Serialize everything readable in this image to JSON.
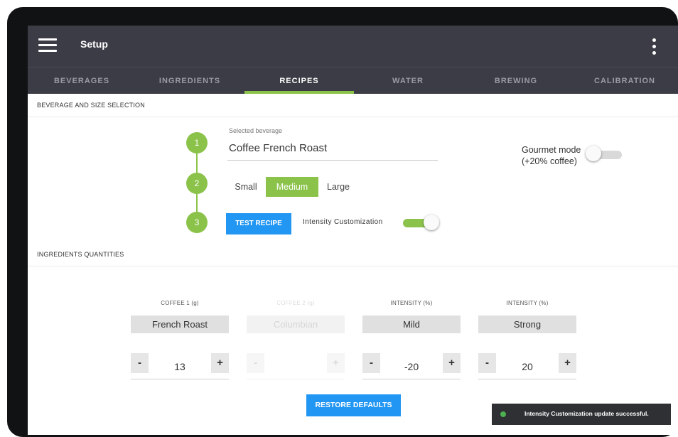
{
  "appbar": {
    "title": "Setup"
  },
  "tabs": [
    {
      "label": "BEVERAGES"
    },
    {
      "label": "INGREDIENTS"
    },
    {
      "label": "RECIPES"
    },
    {
      "label": "WATER"
    },
    {
      "label": "BREWING"
    },
    {
      "label": "CALIBRATION"
    }
  ],
  "active_tab": "RECIPES",
  "beverage_section": {
    "heading": "BEVERAGE AND SIZE SELECTION",
    "steps": [
      "1",
      "2",
      "3"
    ],
    "selected_beverage_label": "Selected beverage",
    "selected_beverage_value": "Coffee French Roast",
    "gourmet_mode_line1": "Gourmet mode",
    "gourmet_mode_line2": "(+20% coffee)",
    "gourmet_mode_on": false,
    "sizes": [
      "Small",
      "Medium",
      "Large"
    ],
    "selected_size": "Medium",
    "test_recipe_label": "TEST RECIPE",
    "intensity_customization_label": "Intensity Customization",
    "intensity_customization_on": true
  },
  "ingredients_section": {
    "heading": "INGREDIENTS QUANTITIES",
    "columns": [
      {
        "label": "COFFEE 1 (g)",
        "select": "French Roast",
        "value": "13",
        "minus": "-",
        "plus": "+",
        "disabled": false
      },
      {
        "label": "COFFEE 2 (g)",
        "select": "Columbian",
        "value": "",
        "minus": "-",
        "plus": "+",
        "disabled": true
      },
      {
        "label": "INTENSITY (%)",
        "select": "Mild",
        "value": "-20",
        "minus": "-",
        "plus": "+",
        "disabled": false
      },
      {
        "label": "INTENSITY (%)",
        "select": "Strong",
        "value": "20",
        "minus": "-",
        "plus": "+",
        "disabled": false
      }
    ],
    "restore_defaults_label": "RESTORE DEFAULTS"
  },
  "toast": {
    "message": "Intensity Customization update successful."
  },
  "colors": {
    "appbar": "#3c3c46",
    "accent_green": "#8bc34a",
    "button_blue": "#2196f3",
    "toast_bg": "#2e3033",
    "toast_dot": "#4caf50"
  }
}
